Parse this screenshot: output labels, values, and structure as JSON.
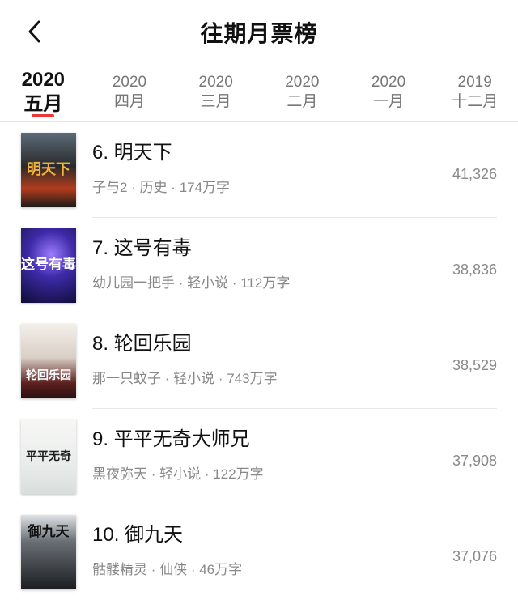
{
  "header": {
    "title": "往期月票榜"
  },
  "tabs": [
    {
      "year": "2020",
      "month": "五月",
      "active": true
    },
    {
      "year": "2020",
      "month": "四月"
    },
    {
      "year": "2020",
      "month": "三月"
    },
    {
      "year": "2020",
      "month": "二月"
    },
    {
      "year": "2020",
      "month": "一月"
    },
    {
      "year": "2019",
      "month": "十二月"
    }
  ],
  "books": [
    {
      "rank_title": "6. 明天下",
      "author": "子与2",
      "genre": "历史",
      "words": "174万字",
      "votes": "41,326",
      "cover_text": "明天下"
    },
    {
      "rank_title": "7. 这号有毒",
      "author": "幼儿园一把手",
      "genre": "轻小说",
      "words": "112万字",
      "votes": "38,836",
      "cover_text": "这号有毒"
    },
    {
      "rank_title": "8. 轮回乐园",
      "author": "那一只蚊子",
      "genre": "轻小说",
      "words": "743万字",
      "votes": "38,529",
      "cover_text": "轮回乐园"
    },
    {
      "rank_title": "9. 平平无奇大师兄",
      "author": "黑夜弥天",
      "genre": "轻小说",
      "words": "122万字",
      "votes": "37,908",
      "cover_text": "平平无奇"
    },
    {
      "rank_title": "10. 御九天",
      "author": "骷髅精灵",
      "genre": "仙侠",
      "words": "46万字",
      "votes": "37,076",
      "cover_text": "御九天"
    }
  ],
  "colors": {
    "accent": "#e83a3a",
    "meta_text": "#888888"
  },
  "icons": {
    "back": "chevron-left-icon"
  }
}
